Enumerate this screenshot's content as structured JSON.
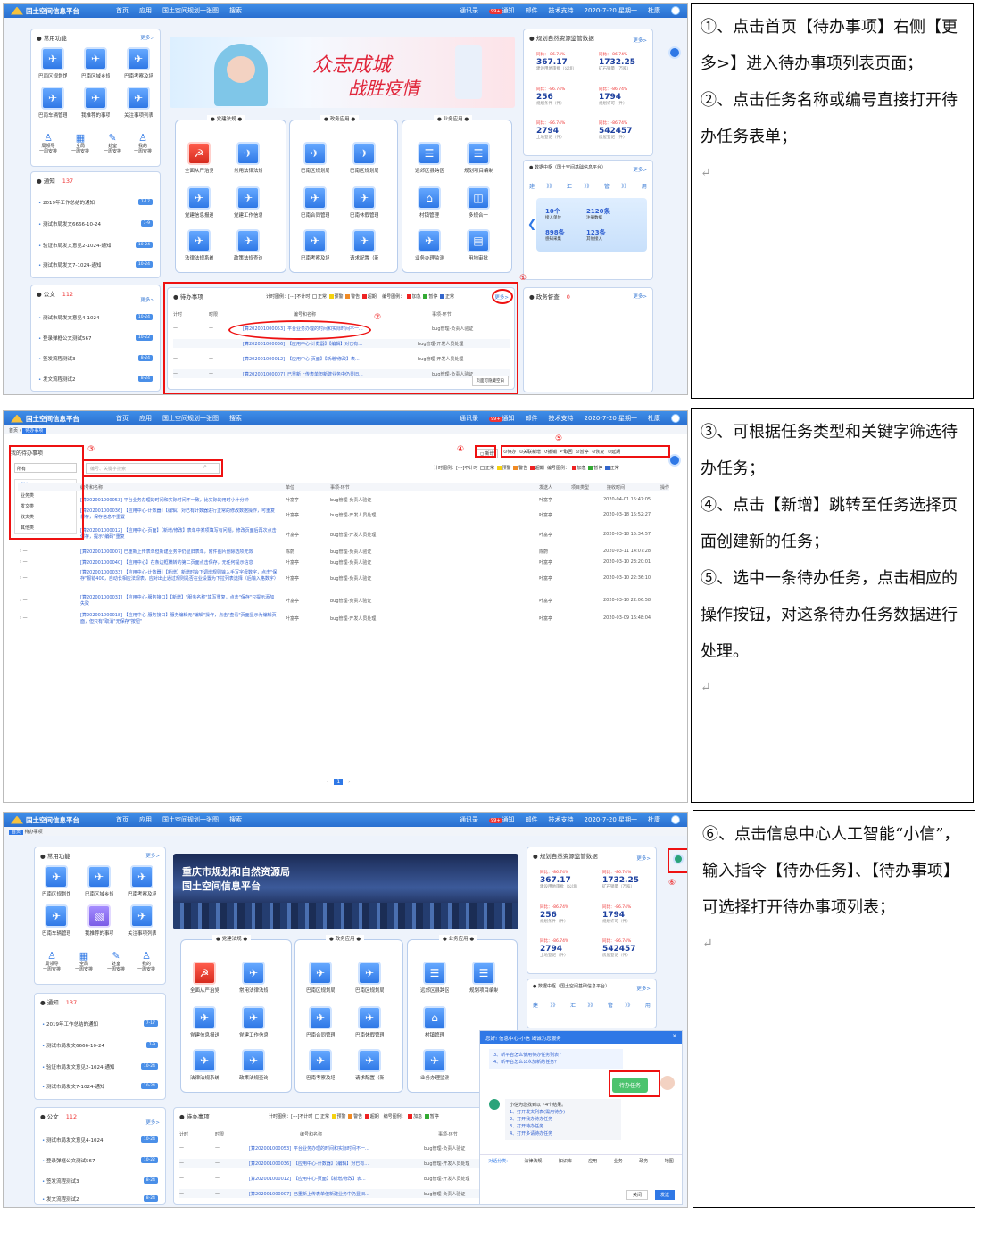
{
  "app": {
    "name": "国土空间信息平台",
    "menu": [
      "首页",
      "应用",
      "国土空间规划一张图",
      "搜索"
    ],
    "right": [
      "通讯录",
      "通知",
      "邮件",
      "技术支持",
      "2020-7-20 星期一",
      "杜康"
    ],
    "notif_badge": "99+"
  },
  "common": {
    "title": "常用功能",
    "more": "更多>",
    "tiles": [
      "巴南区规划馆",
      "巴南区域乡规",
      "巴南考察及培",
      "巴南车辆管理",
      "我推荐的事项",
      "关注事项列表"
    ],
    "small": [
      [
        "局领导",
        "一周安排"
      ],
      [
        "全局",
        "一周安排"
      ],
      [
        "处室",
        "一周安排"
      ],
      [
        "我的",
        "一周安排"
      ]
    ]
  },
  "notice": {
    "title": "通知",
    "count": "137",
    "items": [
      {
        "text": "2019年工作总结的通知",
        "date": "7-17"
      },
      {
        "text": "测试市局发文6666-10-24",
        "date": "7-9"
      },
      {
        "text": "验证市局发文意见2-1024-通知",
        "date": "10-24"
      },
      {
        "text": "测试市局发文7-1024-通知",
        "date": "10-24"
      }
    ]
  },
  "official": {
    "title": "公文",
    "count": "112",
    "items": [
      {
        "text": "测试市局发文意见4-1024",
        "date": "10-24"
      },
      {
        "text": "登录弹框公文测试567",
        "date": "10-22"
      },
      {
        "text": "签发流程测试3",
        "date": "8-24"
      },
      {
        "text": "发文流程测试2",
        "date": "8-24"
      }
    ]
  },
  "banner1": {
    "slogan1": "众志成城",
    "slogan2": "战胜疫情"
  },
  "banner3": {
    "line1": "重庆市规划和自然资源局",
    "line2": "国土空间信息平台"
  },
  "sections": [
    {
      "title": "党建法规",
      "tiles": [
        "全面从严治党",
        "常用法律法规",
        "党建信息报送",
        "党建工作信息",
        "法律法规系统",
        "政策法规查询"
      ]
    },
    {
      "title": "政务应用",
      "tiles": [
        "巴南区规划局",
        "巴南区规划局",
        "巴南合同管理",
        "巴南休假管理",
        "巴南考察及培",
        "请求配置（新"
      ]
    },
    {
      "title": "业务应用",
      "tiles": [
        "远郊区县跨区",
        "规划项目编制",
        "村镇管理",
        "多规合一",
        "业务办理监测",
        "用地审批"
      ]
    }
  ],
  "monitor": {
    "title": "规划自然资源监管数据",
    "more": "更多>",
    "stats": [
      {
        "ratio": "同比：-86.74%",
        "value": "367.17",
        "label": "建设用地审批（公顷）"
      },
      {
        "ratio": "同比：-86.74%",
        "value": "1732.25",
        "label": "矿石销量（万吨）"
      },
      {
        "ratio": "同比：-86.74%",
        "value": "256",
        "label": "规划条件（件）"
      },
      {
        "ratio": "同比：-86.74%",
        "value": "1794",
        "label": "规划许可（件）"
      },
      {
        "ratio": "同比：-86.74%",
        "value": "2794",
        "label": "土地登记（件）"
      },
      {
        "ratio": "同比：-86.74%",
        "value": "542457",
        "label": "房屋登记（件）"
      }
    ]
  },
  "datahub": {
    "title": "数据中枢（国土空间基础信息平台）",
    "more": "更多>",
    "steps": [
      "建",
      "汇",
      "管",
      "用"
    ],
    "cards": [
      {
        "v": "10个",
        "l": "接入单位"
      },
      {
        "v": "2120条",
        "l": "注册数据"
      },
      {
        "v": "898条",
        "l": "感知采集"
      },
      {
        "v": "123条",
        "l": "其他接入"
      }
    ]
  },
  "todo": {
    "title": "待办事项",
    "legend_label": "计时图例：",
    "legend_timing": [
      "[---]不计时",
      "正常",
      "预警",
      "警告",
      "超期"
    ],
    "legend_code_label": "编号图例：",
    "legend_code": [
      "加急",
      "暂停",
      "正常"
    ],
    "more": "更多>",
    "headers": [
      "计时",
      "时限",
      "编号和名称",
      "事项-环节"
    ],
    "rows": [
      {
        "a": "—",
        "b": "—",
        "code": "[算202001000053]",
        "name": "平台业务办理的时间和实际时间不一...",
        "step": "bug管理-负责人验证"
      },
      {
        "a": "—",
        "b": "—",
        "code": "[算202001000036]",
        "name": "【应用中心-计数器】【编辑】对已有...",
        "step": "bug管理-开发人员处理"
      },
      {
        "a": "—",
        "b": "—",
        "code": "[算202001000012]",
        "name": "【应用中心-页面】【新增/修改】表...",
        "step": "bug管理-开发人员处理"
      },
      {
        "a": "—",
        "b": "—",
        "code": "[算202001000007]",
        "name": "已重新上传表单但新建业务中仍显旧...",
        "step": "bug管理-负责人验证"
      }
    ],
    "bottom_btn": "页面可隐藏空白"
  },
  "supervise": {
    "title": "政务督查",
    "count": "0",
    "more": "更多>"
  },
  "list": {
    "breadcrumb": [
      "首页",
      "待办事项"
    ],
    "filter_title": "我的待办事项",
    "filter_value": "所有",
    "filter_options": [
      "所有",
      "业务类",
      "发文类",
      "收文类",
      "其他类"
    ],
    "search_placeholder": "编号、关键字搜索",
    "new_btn": "新增",
    "actions": [
      "待办",
      "关联新增",
      "撤销",
      "取回",
      "暂停",
      "恢复",
      "延期"
    ],
    "legend_label": "计时图例：",
    "legend_timing": [
      "[---]不计时",
      "正常",
      "预警",
      "警告",
      "超期"
    ],
    "legend_code_label": "编号图例：",
    "legend_code": [
      "加急",
      "暂停",
      "正常"
    ],
    "headers": [
      "编号和名称",
      "单位",
      "事项-环节",
      "发送人",
      "项目类型",
      "接收时间",
      "操作"
    ],
    "rows": [
      {
        "text": "[算202001000053] 平台业务办理的时间和实际时间不一致，比实际的用时小十分钟",
        "unit": "叶富亭",
        "step": "bug管理-负责人验证",
        "sender": "叶富亭",
        "time": "2020-04-01 15:47:05"
      },
      {
        "text": "[算202001000036] 【应用中心-计数器】【编辑】对已有计数器进行正常的修改数据操作，可重复保存，保存信息不重置",
        "unit": "叶富亭",
        "step": "bug管理-开发人员处理",
        "sender": "叶富亭",
        "time": "2020-03-18 15:52:27"
      },
      {
        "text": "[算202001000012] 【应用中心-页面】【新增/修改】表单中某项填写有问题，修改页面后再次点击保存，提示\"编码\"重复",
        "unit": "叶富亭",
        "step": "bug管理-开发人员处理",
        "sender": "叶富亭",
        "time": "2020-03-18 15:34:57"
      },
      {
        "text": "[算202001000007] 已重新上传表单但新建业务中仍显旧表单，附件图片删除选项无效",
        "unit": "陈蔚",
        "step": "bug管理-负责人验证",
        "sender": "陈蔚",
        "time": "2020-03-11 14:07:28"
      },
      {
        "text": "[算202001000040] 【应用中心】在条边框横转的第二页面点击保存，无任何提示信息",
        "unit": "叶富亭",
        "step": "bug管理-负责人验证",
        "sender": "叶富亭",
        "time": "2020-03-10 23:20:01"
      },
      {
        "text": "[算202001000033] 【应用中心-计数器】【新增】新增时会下调增规则输入手写字母数字，点击\"保存\"报错400，自动长相应法规表，应对出止通过规则是否在业设置为下拉列表选择（后输入格数字）",
        "unit": "叶富亭",
        "step": "bug管理-负责人验证",
        "sender": "叶富亭",
        "time": "2020-03-10 22:36:10"
      },
      {
        "text": "[算202001000031] 【应用中心-服务接口】【新增】\"服务名称\"填写重复，点击\"保存\"只提示添加失败",
        "unit": "叶富亭",
        "step": "bug管理-负责人验证",
        "sender": "叶富亭",
        "time": "2020-03-10 22:06:58"
      },
      {
        "text": "[算202001000018] 【应用中心-服务接口】服务编辑无\"编辑\"操作，点击\"查看\"页面显示为编辑页面，但只有\"取消\"无保存\"按钮\"",
        "unit": "叶富亭",
        "step": "bug管理-开发人员处理",
        "sender": "叶富亭",
        "time": "2020-03-09 16:48:04"
      }
    ],
    "page": "1"
  },
  "chat": {
    "title": "您好! 信息中心-小信 竭诚为您服务",
    "q1": "3、新平台怎么使用待办任务列表？",
    "q2": "4、新平台怎么公众加新的任务？",
    "user_msg": "待办任务",
    "reply_head": "小信为您找到以下4个结果。",
    "replies": [
      "1、打开发文列表(需用待办)",
      "2、打开我办待办任务",
      "3、打开待办任务",
      "4、打开多请待办任务"
    ],
    "tabs": [
      "对话分类:",
      "法律法规",
      "知识库",
      "应用",
      "业务",
      "政务",
      "地图"
    ],
    "btn_close": "关闭",
    "btn_send": "发送"
  },
  "notes": {
    "n1": [
      "①、点击首页【待办事项】右侧【更多>】进入待办事项列表页面；",
      "②、点击任务名称或编号直接打开待办任务表单；"
    ],
    "n2": [
      "③、可根据任务类型和关键字筛选待办任务；",
      "④、点击【新增】跳转至任务选择页面创建新的任务；",
      "⑤、选中一条待办任务，点击相应的操作按钮，对这条待办任务数据进行处理。"
    ],
    "n3": [
      "⑥、点击信息中心人工智能“小信”，输入指令【待办任务】、【待办事项】可选择打开待办事项列表；"
    ],
    "return_mark": "↵"
  },
  "markers": [
    "①",
    "②",
    "③",
    "④",
    "⑤",
    "⑥"
  ],
  "colors": {
    "accent": "#2f78e6",
    "topbar": "#2a6fd0",
    "red": "#e11111",
    "date_badge": "#4a8fe8"
  }
}
